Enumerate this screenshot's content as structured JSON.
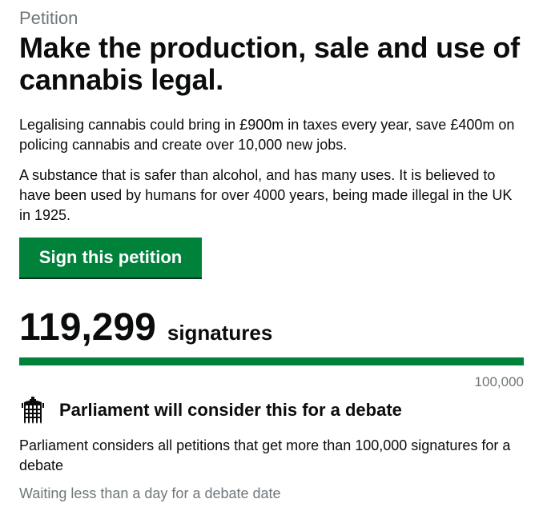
{
  "petition": {
    "kicker": "Petition",
    "title": "Make the production, sale and use of cannabis legal.",
    "paragraphs": [
      "Legalising cannabis could bring in £900m in taxes every year, save £400m on policing cannabis and create over 10,000 new jobs.",
      "A substance that is safer than alcohol, and has many uses. It is believed to have been used by humans for over 4000 years, being made illegal in the UK in 1925."
    ],
    "sign_button_label": "Sign this petition"
  },
  "signatures": {
    "count": "119,299",
    "label": "signatures",
    "threshold_label": "100,000",
    "progress_fraction": 1.0
  },
  "debate": {
    "icon": "portcullis-icon",
    "heading": "Parliament will consider this for a debate",
    "text": "Parliament considers all petitions that get more than 100,000 signatures for a debate",
    "status": "Waiting less than a day for a debate date"
  },
  "colors": {
    "primary_green": "#00823b",
    "grey_text": "#6f777b",
    "text": "#0b0c0c"
  }
}
